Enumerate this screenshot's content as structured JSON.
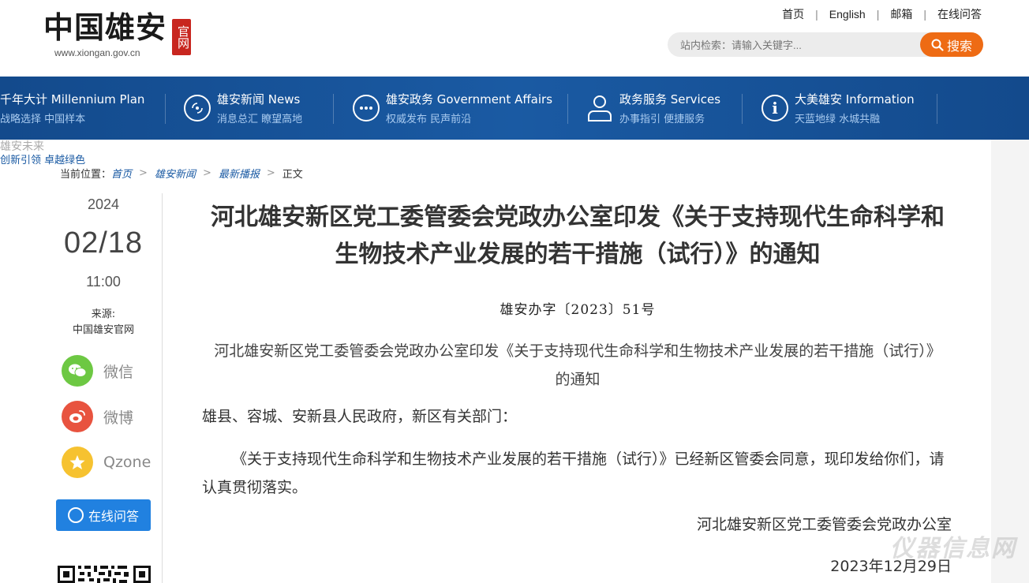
{
  "brand": {
    "logo_text": "中国雄安",
    "seal_text": "官网",
    "url": "www.xiongan.gov.cn"
  },
  "toplinks": [
    "首页",
    "English",
    "邮箱",
    "在线问答"
  ],
  "search": {
    "placeholder": "站内检索：请输入关键字...",
    "button": "搜索"
  },
  "nav": {
    "items": [
      {
        "title": "千年大计 Millennium Plan",
        "sub": "战略选择 中国样本",
        "icon": "building-icon"
      },
      {
        "title": "雄安新闻 News",
        "sub": "消息总汇 瞭望高地",
        "icon": "news-icon"
      },
      {
        "title": "雄安政务 Government Affairs",
        "sub": "权威发布 民声前沿",
        "icon": "chat-icon"
      },
      {
        "title": "政务服务 Services",
        "sub": "办事指引 便捷服务",
        "icon": "user-icon"
      },
      {
        "title": "大美雄安 Information",
        "sub": "天蓝地绿 水城共融",
        "icon": "info-icon"
      }
    ],
    "overflow_title": "雄安未来",
    "overflow_sub": "创新引领 卓越绿色"
  },
  "breadcrumb": {
    "label": "当前位置：",
    "items": [
      "首页",
      "雄安新闻",
      "最新播报",
      "正文"
    ]
  },
  "meta": {
    "year": "2024",
    "month_day": "02/18",
    "time": "11:00",
    "source_label": "来源:",
    "source": "中国雄安官网"
  },
  "share": {
    "wechat": "微信",
    "weibo": "微博",
    "qzone": "Qzone",
    "qa_button": "在线问答"
  },
  "article": {
    "title": "河北雄安新区党工委管委会党政办公室印发《关于支持现代生命科学和生物技术产业发展的若干措施（试行）》的通知",
    "doc_no": "雄安办字〔2023〕51号",
    "sub_title": "河北雄安新区党工委管委会党政办公室印发《关于支持现代生命科学和生物技术产业发展的若干措施（试行）》的通知",
    "address": "雄县、容城、安新县人民政府，新区有关部门：",
    "body": "《关于支持现代生命科学和生物技术产业发展的若干措施（试行）》已经新区管委会同意，现印发给你们，请认真贯彻落实。",
    "signature": "河北雄安新区党工委管委会党政办公室",
    "sign_date": "2023年12月29日"
  },
  "watermark": "仪器信息网",
  "colors": {
    "nav_blue": "#134a8c",
    "search_orange": "#ee6b14",
    "qa_blue": "#2181e0",
    "seal_red": "#c8261f",
    "wechat_green": "#6dc843",
    "weibo_red": "#e8533f",
    "qzone_yellow": "#f6c230"
  }
}
